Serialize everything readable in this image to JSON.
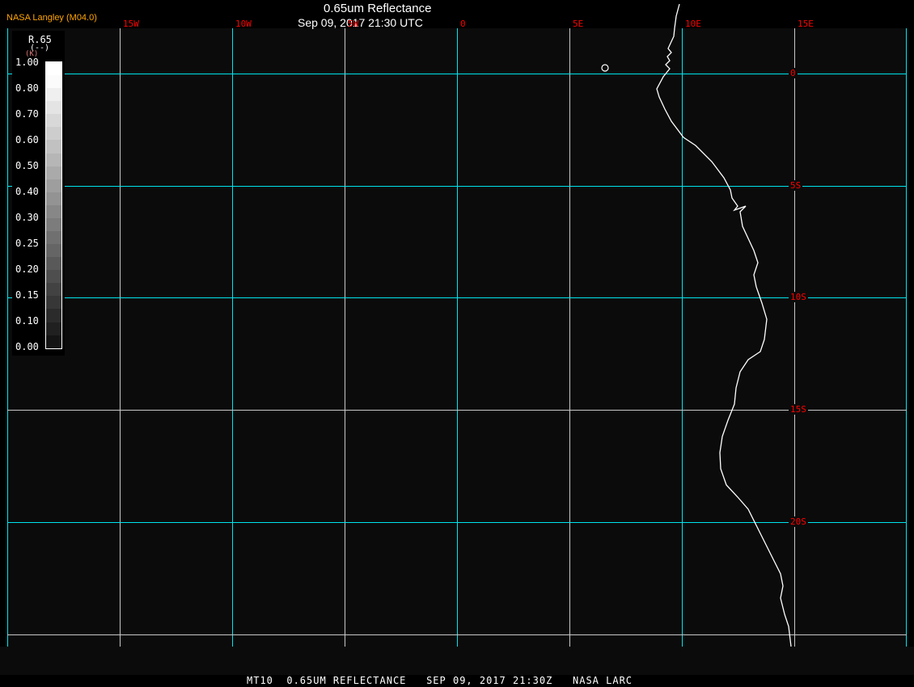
{
  "header": {
    "title": "0.65um Reflectance",
    "datetime": "Sep 09, 2017 21:30 UTC",
    "brand": "NASA Langley (M04.0)"
  },
  "footer": "MT10  0.65UM REFLECTANCE   SEP 09, 2017 21:30Z   NASA LARC",
  "colorbar": {
    "name": "R.65",
    "units": "(--)",
    "units2": "(K)",
    "labels": [
      "1.00",
      "0.80",
      "0.70",
      "0.60",
      "0.50",
      "0.40",
      "0.30",
      "0.25",
      "0.20",
      "0.15",
      "0.10",
      "0.00"
    ]
  },
  "lon_labels": [
    "15W",
    "10W",
    "5W",
    "0",
    "5E",
    "10E",
    "15E"
  ],
  "lat_labels": [
    "0",
    "5S",
    "10S",
    "15S",
    "20S"
  ],
  "colors": {
    "background": "#0b0b0b",
    "grid_major": "#00e5ee",
    "grid_minor": "#c8c8c8",
    "grid_label": "#ff0000",
    "coast": "#ffffff",
    "brand": "#ffa500"
  }
}
